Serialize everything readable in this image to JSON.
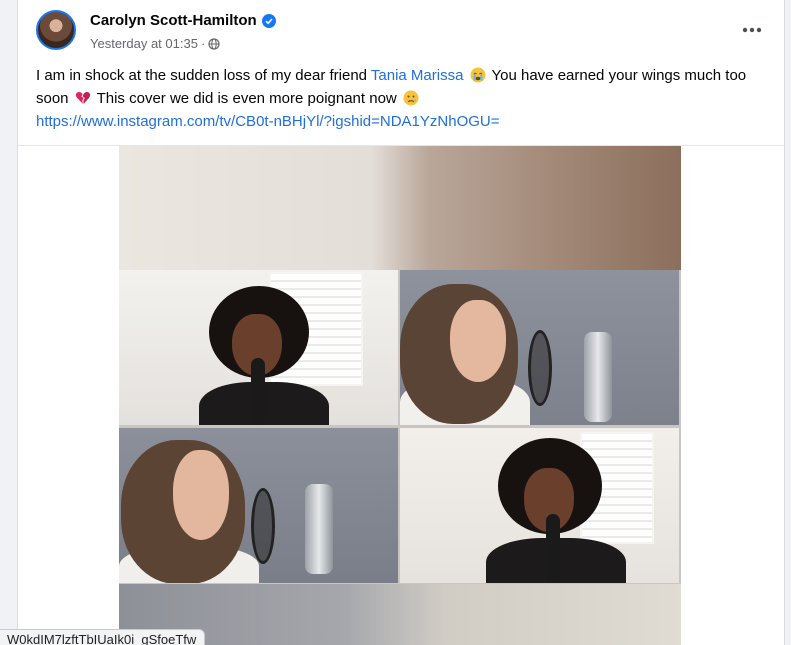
{
  "post": {
    "author": "Carolyn Scott-Hamilton",
    "timestamp": "Yesterday at 01:35",
    "separator": "·",
    "text_part1": "I am in shock at the sudden loss of my dear friend ",
    "mention": "Tania Marissa",
    "text_part2": " You have earned your wings much too soon ",
    "text_part3": " This cover we did is even more poignant now ",
    "link": "https://www.instagram.com/tv/CB0t-nBHjYl/?igshid=NDA1YzNhOGU=",
    "emojis": [
      "crying-face",
      "broken-heart",
      "sad-tear-face"
    ]
  },
  "status_bar": {
    "url": "W0kdIM7lzftTbIUaIk0i_gSfoeTfw"
  },
  "icons": {
    "verified": "verified-badge-icon",
    "audience": "globe-icon",
    "more": "more-options-icon"
  },
  "colors": {
    "accent": "#1877f2",
    "link": "#216fdb",
    "text": "#050505",
    "meta": "#65676b"
  }
}
